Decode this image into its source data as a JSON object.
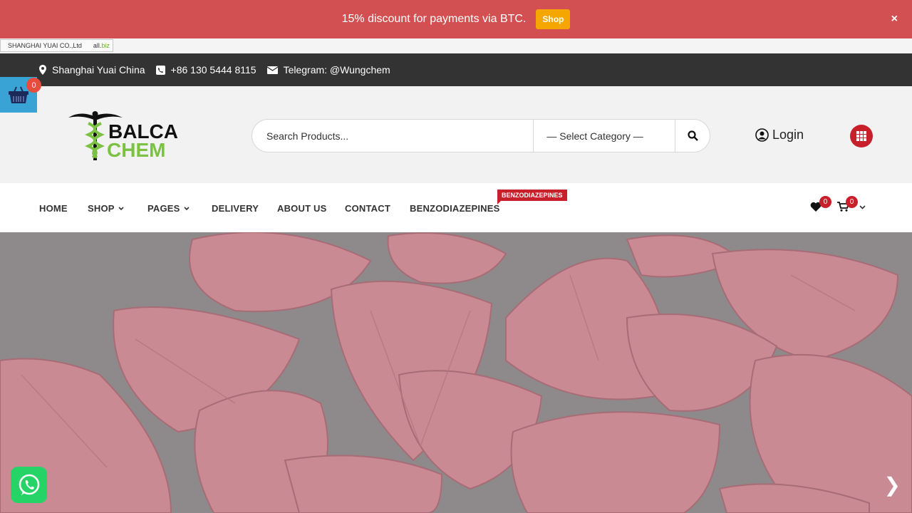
{
  "promo": {
    "text": "15% discount for payments via BTC.",
    "button": "Shop",
    "close": "×"
  },
  "allbiz": {
    "company": "SHANGHAI YUAI CO.,Ltd",
    "brand_prefix": "all.",
    "brand_suffix": "biz"
  },
  "contact": {
    "location": "Shanghai Yuai China",
    "phone": "+86 130 5444 8115",
    "telegram": "Telegram: @Wungchem"
  },
  "float_cart": {
    "count": "0"
  },
  "logo": {
    "line1": "BALCA",
    "line2": "CHEM"
  },
  "search": {
    "placeholder": "Search Products...",
    "category": "— Select Category —"
  },
  "login": {
    "label": "Login"
  },
  "nav": {
    "items": [
      {
        "label": "HOME"
      },
      {
        "label": "SHOP"
      },
      {
        "label": "PAGES"
      },
      {
        "label": "DELIVERY"
      },
      {
        "label": "ABOUT US"
      },
      {
        "label": "CONTACT"
      },
      {
        "label": "BENZODIAZEPINES"
      }
    ],
    "badge": "BENZODIAZEPINES",
    "wishlist_count": "0",
    "cart_count": "0"
  },
  "hero": {
    "next": "❯"
  },
  "colors": {
    "promo": "#d35052",
    "accent": "#c8202a",
    "logo_green": "#7bc142",
    "contact_bar": "#333333",
    "float_basket": "#3aa3d6",
    "whatsapp": "#25d366"
  },
  "icons": [
    "map-marker-icon",
    "phone-icon",
    "envelope-icon",
    "basket-icon",
    "search-icon",
    "user-icon",
    "grid-icon",
    "chevron-down-icon",
    "heart-icon",
    "cart-icon",
    "whatsapp-icon",
    "next-arrow-icon"
  ]
}
